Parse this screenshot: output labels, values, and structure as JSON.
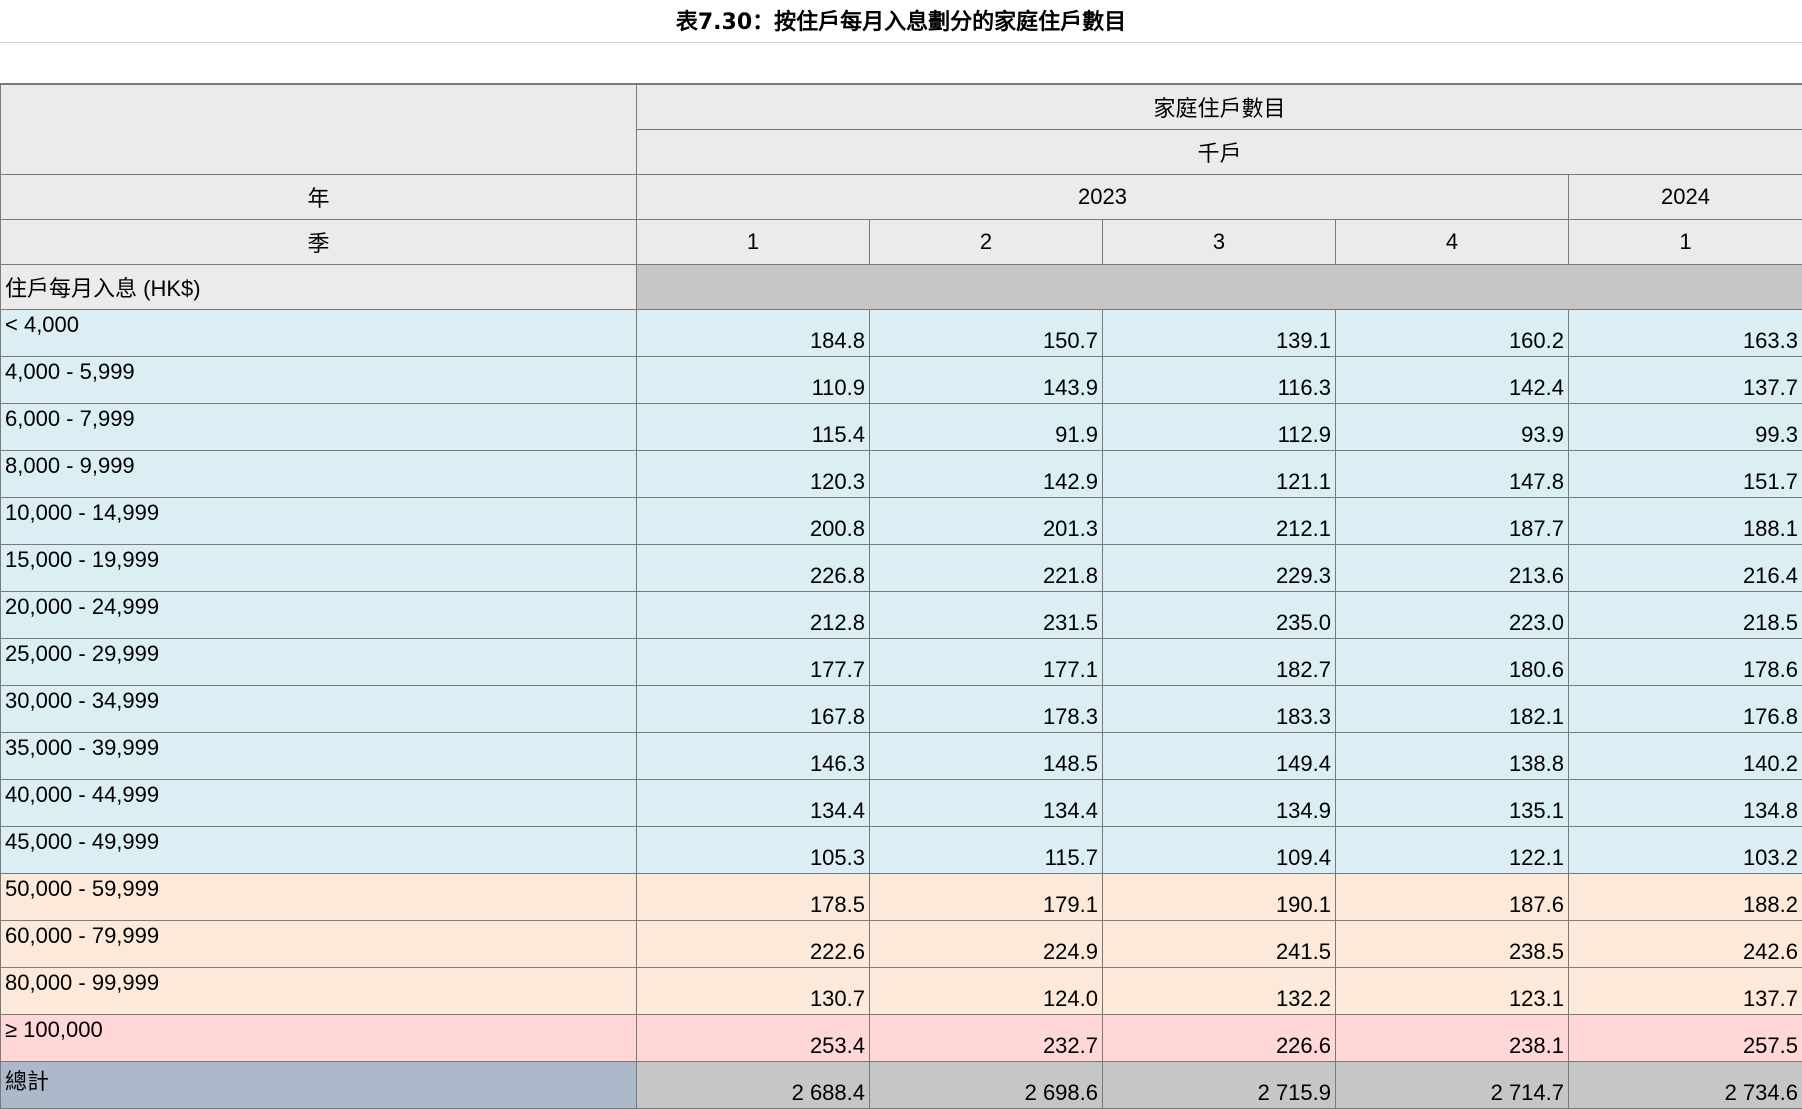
{
  "title": "表7.30：按住戶每月入息劃分的家庭住戶數目",
  "header": {
    "measure": "家庭住戶數目",
    "unit": "千戶",
    "year_label": "年",
    "quarter_label": "季",
    "years": [
      "2023",
      "2024"
    ],
    "quarters": [
      "1",
      "2",
      "3",
      "4",
      "1"
    ]
  },
  "section_label": "住戶每月入息 (HK$)",
  "rows": [
    {
      "label": "< 4,000",
      "values": [
        "184.8",
        "150.7",
        "139.1",
        "160.2",
        "163.3"
      ],
      "band": "blue"
    },
    {
      "label": "4,000 - 5,999",
      "values": [
        "110.9",
        "143.9",
        "116.3",
        "142.4",
        "137.7"
      ],
      "band": "blue"
    },
    {
      "label": "6,000 - 7,999",
      "values": [
        "115.4",
        "91.9",
        "112.9",
        "93.9",
        "99.3"
      ],
      "band": "blue"
    },
    {
      "label": "8,000 - 9,999",
      "values": [
        "120.3",
        "142.9",
        "121.1",
        "147.8",
        "151.7"
      ],
      "band": "blue"
    },
    {
      "label": "10,000 - 14,999",
      "values": [
        "200.8",
        "201.3",
        "212.1",
        "187.7",
        "188.1"
      ],
      "band": "blue"
    },
    {
      "label": "15,000 - 19,999",
      "values": [
        "226.8",
        "221.8",
        "229.3",
        "213.6",
        "216.4"
      ],
      "band": "blue"
    },
    {
      "label": "20,000 - 24,999",
      "values": [
        "212.8",
        "231.5",
        "235.0",
        "223.0",
        "218.5"
      ],
      "band": "blue"
    },
    {
      "label": "25,000 - 29,999",
      "values": [
        "177.7",
        "177.1",
        "182.7",
        "180.6",
        "178.6"
      ],
      "band": "blue"
    },
    {
      "label": "30,000 - 34,999",
      "values": [
        "167.8",
        "178.3",
        "183.3",
        "182.1",
        "176.8"
      ],
      "band": "blue"
    },
    {
      "label": "35,000 - 39,999",
      "values": [
        "146.3",
        "148.5",
        "149.4",
        "138.8",
        "140.2"
      ],
      "band": "blue"
    },
    {
      "label": "40,000 - 44,999",
      "values": [
        "134.4",
        "134.4",
        "134.9",
        "135.1",
        "134.8"
      ],
      "band": "blue"
    },
    {
      "label": "45,000 - 49,999",
      "values": [
        "105.3",
        "115.7",
        "109.4",
        "122.1",
        "103.2"
      ],
      "band": "blue"
    },
    {
      "label": "50,000 - 59,999",
      "values": [
        "178.5",
        "179.1",
        "190.1",
        "187.6",
        "188.2"
      ],
      "band": "peach"
    },
    {
      "label": "60,000 - 79,999",
      "values": [
        "222.6",
        "224.9",
        "241.5",
        "238.5",
        "242.6"
      ],
      "band": "peach"
    },
    {
      "label": "80,000 - 99,999",
      "values": [
        "130.7",
        "124.0",
        "132.2",
        "123.1",
        "137.7"
      ],
      "band": "peach"
    },
    {
      "label": "≥ 100,000",
      "values": [
        "253.4",
        "232.7",
        "226.6",
        "238.1",
        "257.5"
      ],
      "band": "pink"
    }
  ],
  "total": {
    "label": "總計",
    "values": [
      "2 688.4",
      "2 698.6",
      "2 715.9",
      "2 714.7",
      "2 734.6"
    ]
  },
  "colors": {
    "band_blue": "#daeef3",
    "band_peach": "#fde9d9",
    "band_pink": "#ffd7d7",
    "header_gray": "#ebebeb",
    "total_label": "#acb9ca",
    "total_values": "#c6c6c6"
  }
}
